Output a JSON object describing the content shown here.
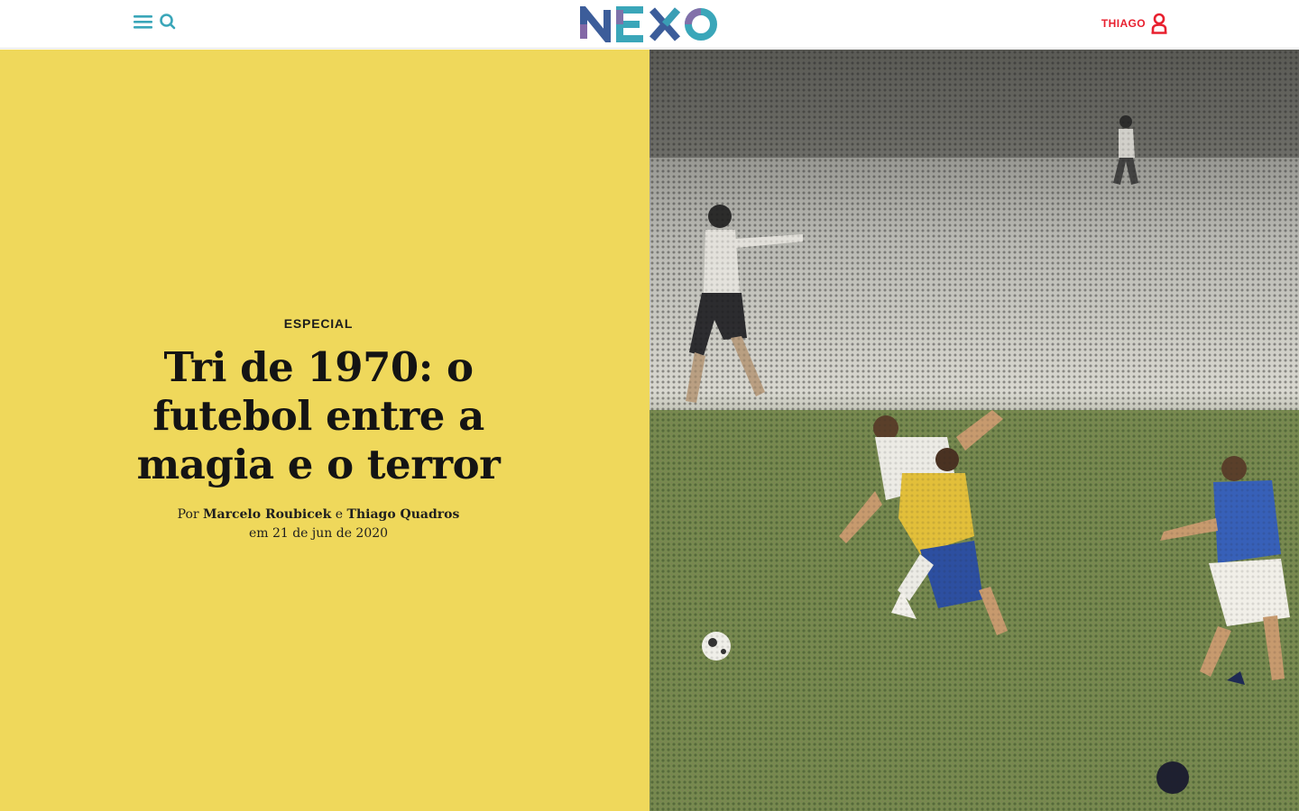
{
  "header": {
    "menu_icon": "hamburger-menu-icon",
    "search_icon": "search-icon",
    "logo_text": "NEXO",
    "user_name": "THIAGO",
    "user_icon": "user-icon"
  },
  "colors": {
    "accent_teal": "#3aa6b9",
    "logo_blue": "#3c5d9a",
    "logo_purple": "#8b6aa8",
    "user_red": "#e8202f",
    "hero_yellow": "#efd85b"
  },
  "article": {
    "kicker": "ESPECIAL",
    "title": "Tri de 1970: o futebol entre a magia e o terror",
    "byline_prefix": "Por",
    "author_1": "Marcelo Roubicek",
    "byline_conj": "e",
    "author_2": "Thiago Quadros",
    "date": "em 21 de jun de 2020"
  },
  "hero_image": {
    "description_icon": "football-match-photo"
  }
}
